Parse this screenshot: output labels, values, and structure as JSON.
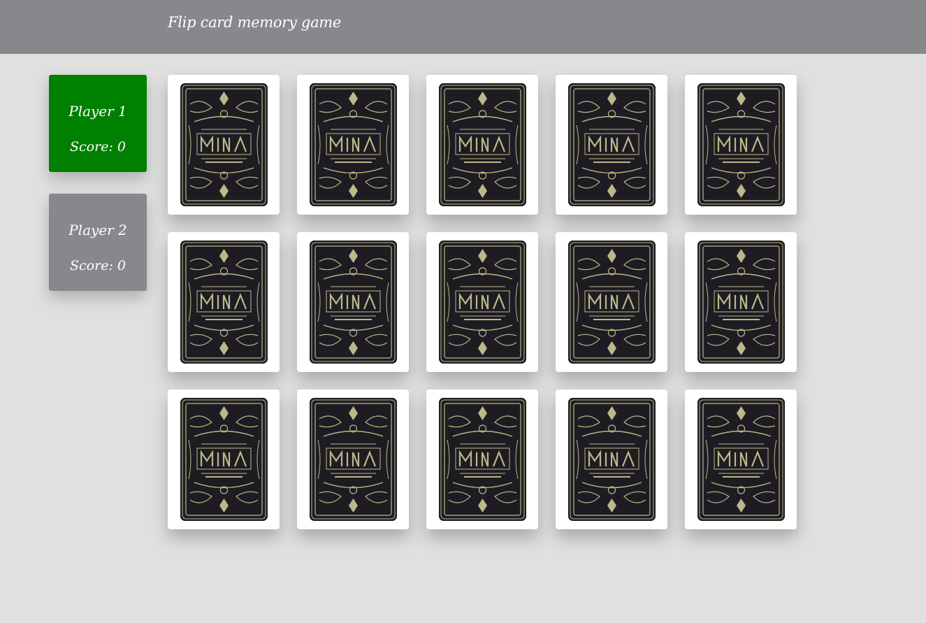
{
  "header": {
    "title": "Flip card memory game"
  },
  "players": [
    {
      "name": "Player 1",
      "score_label": "Score: ",
      "score": "0",
      "active": true
    },
    {
      "name": "Player 2",
      "score_label": "Score: ",
      "score": "0",
      "active": false
    }
  ],
  "colors": {
    "header_bg": "#86888c",
    "page_bg": "#e0e0e0",
    "active_player": "#008000",
    "inactive_player": "#86888c",
    "card_face_down_bg": "#1e1c22",
    "card_ornament": "#b9b98a"
  },
  "board": {
    "rows": 3,
    "columns": 5,
    "cards": [
      {
        "state": "face-down",
        "back_design": "ornate-card-back"
      },
      {
        "state": "face-down",
        "back_design": "ornate-card-back"
      },
      {
        "state": "face-down",
        "back_design": "ornate-card-back"
      },
      {
        "state": "face-down",
        "back_design": "ornate-card-back"
      },
      {
        "state": "face-down",
        "back_design": "ornate-card-back"
      },
      {
        "state": "face-down",
        "back_design": "ornate-card-back"
      },
      {
        "state": "face-down",
        "back_design": "ornate-card-back"
      },
      {
        "state": "face-down",
        "back_design": "ornate-card-back"
      },
      {
        "state": "face-down",
        "back_design": "ornate-card-back"
      },
      {
        "state": "face-down",
        "back_design": "ornate-card-back"
      },
      {
        "state": "face-down",
        "back_design": "ornate-card-back"
      },
      {
        "state": "face-down",
        "back_design": "ornate-card-back"
      },
      {
        "state": "face-down",
        "back_design": "ornate-card-back"
      },
      {
        "state": "face-down",
        "back_design": "ornate-card-back"
      },
      {
        "state": "face-down",
        "back_design": "ornate-card-back"
      }
    ]
  }
}
